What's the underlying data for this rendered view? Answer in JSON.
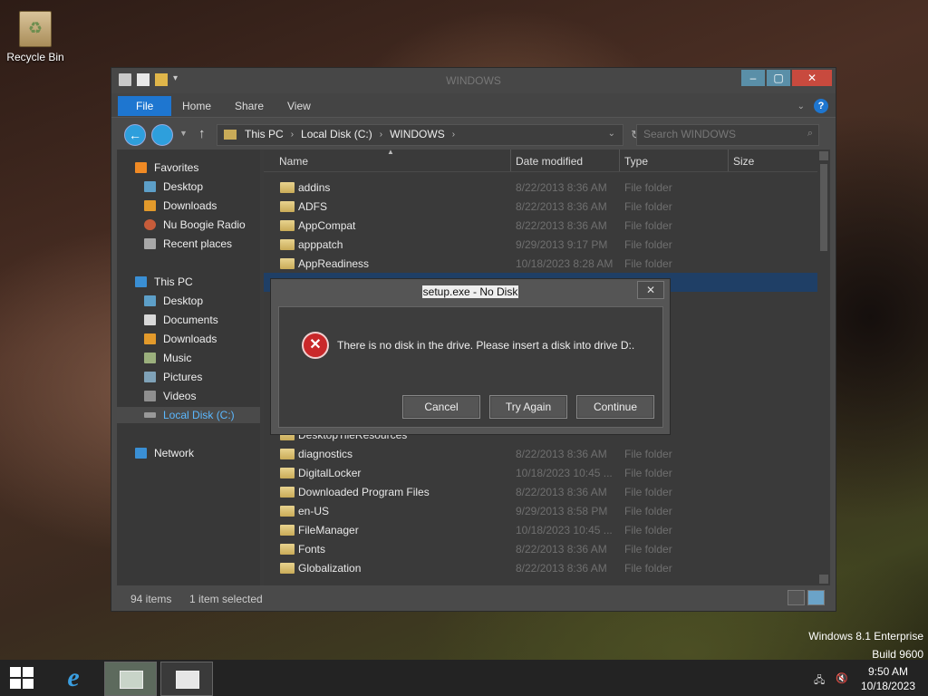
{
  "desktop": {
    "recycle_bin": "Recycle Bin"
  },
  "window": {
    "title": "WINDOWS",
    "ribbon_tabs": [
      "File",
      "Home",
      "Share",
      "View"
    ],
    "address": [
      "This PC",
      "Local Disk (C:)",
      "WINDOWS"
    ],
    "search_placeholder": "Search WINDOWS"
  },
  "nav_pane": {
    "favorites": "Favorites",
    "favorites_items": [
      "Desktop",
      "Downloads",
      "Nu Boogie Radio",
      "Recent places"
    ],
    "this_pc": "This PC",
    "this_pc_items": [
      "Desktop",
      "Documents",
      "Downloads",
      "Music",
      "Pictures",
      "Videos",
      "Local Disk (C:)"
    ],
    "network": "Network"
  },
  "columns": {
    "name": "Name",
    "date": "Date modified",
    "type": "Type",
    "size": "Size"
  },
  "files": [
    {
      "name": "addins",
      "date": "8/22/2013 8:36 AM",
      "type": "File folder"
    },
    {
      "name": "ADFS",
      "date": "8/22/2013 8:36 AM",
      "type": "File folder"
    },
    {
      "name": "AppCompat",
      "date": "8/22/2013 8:36 AM",
      "type": "File folder"
    },
    {
      "name": "apppatch",
      "date": "9/29/2013 9:17 PM",
      "type": "File folder"
    },
    {
      "name": "AppReadiness",
      "date": "10/18/2023 8:28 AM",
      "type": "File folder"
    },
    {
      "name": "DesktopTileResources",
      "date": "",
      "type": ""
    },
    {
      "name": "diagnostics",
      "date": "8/22/2013 8:36 AM",
      "type": "File folder"
    },
    {
      "name": "DigitalLocker",
      "date": "10/18/2023 10:45 ...",
      "type": "File folder"
    },
    {
      "name": "Downloaded Program Files",
      "date": "8/22/2013 8:36 AM",
      "type": "File folder"
    },
    {
      "name": "en-US",
      "date": "9/29/2013 8:58 PM",
      "type": "File folder"
    },
    {
      "name": "FileManager",
      "date": "10/18/2023 10:45 ...",
      "type": "File folder"
    },
    {
      "name": "Fonts",
      "date": "8/22/2013 8:36 AM",
      "type": "File folder"
    },
    {
      "name": "Globalization",
      "date": "8/22/2013 8:36 AM",
      "type": "File folder"
    }
  ],
  "status": {
    "count": "94 items",
    "selected": "1 item selected"
  },
  "dialog": {
    "title": "setup.exe - No Disk",
    "message": "There is no disk in the drive. Please insert a disk into drive D:.",
    "buttons": [
      "Cancel",
      "Try Again",
      "Continue"
    ]
  },
  "watermark": {
    "line1": "Windows 8.1 Enterprise",
    "line2": "Build 9600"
  },
  "taskbar": {
    "time": "9:50 AM",
    "date": "10/18/2023"
  },
  "colors": {
    "accent": "#1e76d0",
    "error": "#c9282a"
  }
}
